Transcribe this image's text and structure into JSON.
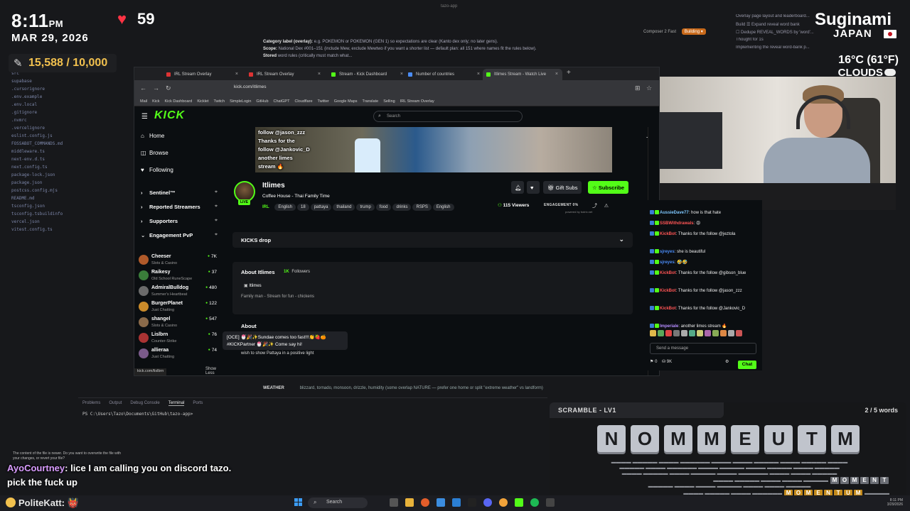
{
  "editor": {
    "top_title": "tazo-app",
    "file_tab": "...plan.md",
    "composer": "Composer 2 Fast",
    "composer_pill": "Building ▾",
    "sidebar_files": [
      "src",
      "supabase",
      ".cursorignore",
      ".env.example",
      ".env.local",
      ".gitignore",
      ".nvmrc",
      ".vercelignore",
      "eslint.config.js",
      "FOSSABOT_COMMANDS.md",
      "middleware.ts",
      "next-env.d.ts",
      "next.config.ts",
      "package-lock.json",
      "package.json",
      "postcss.config.mjs",
      "README.md",
      "tsconfig.json",
      "tsconfig.tsbuildinfo",
      "vercel.json",
      "vitest.config.ts"
    ],
    "doc_lines": [
      {
        "bold": "Category label (overlay):",
        "text": " e.g. POKEMON or POKEMON (GEN 1) so expectations are clear (Kanto dex only; no later gens)."
      },
      {
        "bold": "Scope:",
        "text": " National Dex #001–151 (include Mew, exclude Mewtwo if you want a shorter list — default plan: all 151 where names fit the rules below)."
      },
      {
        "bold": "Stored",
        "text": " word rules (critically must match what... "
      }
    ],
    "right_lines": [
      "Overlay page layout and leaderboard...",
      "Build  ☰ Expand reveal word bank",
      "☐ Dedupe REVEAL_WORDS by 'word'...",
      "Thought for 1s",
      "Implementing the reveal word-bank p..."
    ],
    "weather_label": "WEATHER",
    "weather_text": "blizzard, tornado, monsoon, drizzle, humidity (some overlap NATURE — prefer one home or split \"extreme weather\" vs landform)",
    "panel_tabs": [
      "Problems",
      "Output",
      "Debug Console",
      "Terminal",
      "Ports"
    ],
    "active_panel_tab": "Terminal",
    "terminal_line": "PS C:\\Users\\Tazo\\Documents\\GitHub\\tazo-app>"
  },
  "overlay": {
    "time": "8:11",
    "ampm": "PM",
    "date": "MAR 29, 2026",
    "heart_rate": "59",
    "goal": "15,588 / 10,000",
    "streamer": "Suginami",
    "country": "JAPAN",
    "temperature": "16°C (61°F)",
    "condition": "CLOUDS"
  },
  "browser": {
    "tabs": [
      {
        "label": "IRL Stream Overlay",
        "color": "#d33"
      },
      {
        "label": "IRL Stream Overlay",
        "color": "#d33"
      },
      {
        "label": "Stream - Kick Dashboard",
        "color": "#53fc18"
      },
      {
        "label": "Number of countries",
        "color": "#4a8cf7"
      },
      {
        "label": "Itlimes Stream - Watch Live",
        "color": "#53fc18"
      }
    ],
    "url": "kick.com/itlimes",
    "bookmarks": [
      "Mail",
      "Kick",
      "Kick Dashboard",
      "Kicklet",
      "Twitch",
      "SimpleLogin",
      "GitHub",
      "ChatGPT",
      "Cloudflare",
      "Twitter",
      "Google Maps",
      "Translate",
      "Selling",
      "IRL Stream Overlay"
    ]
  },
  "kick": {
    "logo": "KICK",
    "search_placeholder": "Search",
    "nav": [
      {
        "icon": "⌂",
        "label": "Home"
      },
      {
        "icon": "◫",
        "label": "Browse"
      },
      {
        "icon": "♥",
        "label": "Following"
      }
    ],
    "sections": [
      {
        "chev": "›",
        "label": "Sentinel™"
      },
      {
        "chev": "›",
        "label": "Reported Streamers"
      },
      {
        "chev": "›",
        "label": "Supporters"
      },
      {
        "chev": "⌄",
        "label": "Engagement PvP"
      }
    ],
    "following": [
      {
        "name": "Cheeser",
        "category": "Slots & Casino",
        "viewers": "7K",
        "color": "#b05a2a"
      },
      {
        "name": "Raikesy",
        "category": "Old School RuneScape",
        "viewers": "37",
        "color": "#3a7d3a"
      },
      {
        "name": "AdmiralBulldog",
        "category": "Summer's Heartbeat",
        "viewers": "480",
        "color": "#6b6b6b"
      },
      {
        "name": "BurgerPlanet",
        "category": "Just Chatting",
        "viewers": "122",
        "color": "#c98a2a"
      },
      {
        "name": "shangel",
        "category": "Slots & Casino",
        "viewers": "547",
        "color": "#8a6a4a"
      },
      {
        "name": "Lislbrn",
        "category": "Counter-Strike",
        "viewers": "76",
        "color": "#a33"
      },
      {
        "name": "allieraa",
        "category": "Just Chatting",
        "viewers": "74",
        "color": "#7a5a8a"
      }
    ],
    "show_less": "Show Less",
    "hover_url": "kick.com/lislbrn",
    "banner_lines": [
      "follow @jason_zzz",
      "Thanks for the",
      "follow @Jankovic_D",
      "another limes",
      "stream 🔥"
    ],
    "channel": "Itlimes",
    "live": "LIVE",
    "stream_title": "Coffee House - Thai Family Time",
    "category": "IRL",
    "tags": [
      "English",
      "18",
      "pattaya",
      "thailand",
      "trump",
      "food",
      "drinks",
      "RSPS",
      "English"
    ],
    "gift_subs": "Gift Subs",
    "subscribe": "Subscribe",
    "viewers": "115 Viewers",
    "engagement": "ENGAGEMENT  0%",
    "engagement_sub": "powered by botrix.net",
    "kicks_drop": "KICKS drop",
    "about_title": "About Itlimes",
    "followers_count": "1K",
    "followers_label": "Followers",
    "social": "Itlimes",
    "bio": "Family man - Stream for fun - chickens",
    "about2": "About",
    "tooltip_line1": "[OCE] 🍧🎉✨Sundae comes too fast!!!👏🍓🍊",
    "tooltip_line2": "#KICKPartner 🍧🎉✨ Come say hi!",
    "description": "wish to show Pattaya in a positive light"
  },
  "chat": {
    "messages": [
      {
        "user": "AussieDave77",
        "text": ": how is that hate",
        "color": "#7ec8ff"
      },
      {
        "user": "SSBWithdrawals",
        "text": ": 😡",
        "color": "#ff5555"
      },
      {
        "user": "KickBot",
        "text": ": Thanks for the follow @jeztola",
        "color": "#ff5555"
      },
      {
        "user": "sjreyes",
        "text": ": she is beautiful",
        "color": "#4a8cf7"
      },
      {
        "user": "sjreyes",
        "text": ": 🤣🤣",
        "color": "#4a8cf7"
      },
      {
        "user": "KickBot",
        "text": ": Thanks for the follow @gibson_blue",
        "color": "#ff5555"
      },
      {
        "user": "KickBot",
        "text": ": Thanks for the follow @jason_zzz",
        "color": "#ff5555"
      },
      {
        "user": "KickBot",
        "text": ": Thanks for the follow @Jankovic_D",
        "color": "#ff5555"
      },
      {
        "user": "Imperiale",
        "text": ": another limes stream 🔥",
        "color": "#b58cff"
      }
    ],
    "placeholder": "Send a message",
    "kicks": "0",
    "points": "9K",
    "send": "Chat"
  },
  "scramble": {
    "title": "SCRAMBLE - LV1",
    "progress": "2 / 5 words",
    "letters": [
      "N",
      "O",
      "M",
      "M",
      "E",
      "U",
      "T",
      "M"
    ],
    "solved_word_1": [
      "M",
      "O",
      "M",
      "E",
      "N",
      "T"
    ],
    "solved_word_2": [
      "M",
      "O",
      "M",
      "E",
      "N",
      "T",
      "U",
      "M"
    ]
  },
  "bottom_chat": {
    "popup": "The content of the file is newer. Do you want to overwrite the file with your changes, or revert your file?",
    "user1": "AyoCourtney",
    "msg1": ": lice I am calling you on discord tazo.",
    "msg2": "pick the fuck up",
    "user2": "PoliteKatt",
    "msg3": ": 👹"
  },
  "taskbar": {
    "search": "Search",
    "tray_time": "8:11 PM",
    "tray_date": "3/29/2026"
  }
}
